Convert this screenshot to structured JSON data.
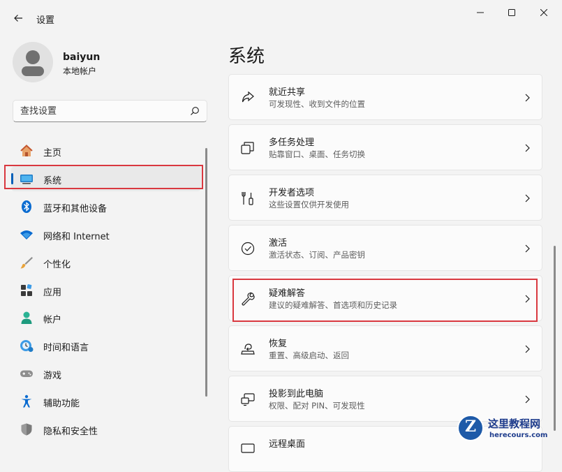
{
  "window": {
    "title": "设置",
    "controls": [
      "minimize",
      "maximize",
      "close"
    ]
  },
  "account": {
    "name": "baiyun",
    "type": "本地帐户"
  },
  "search": {
    "placeholder": "查找设置"
  },
  "nav": {
    "items": [
      {
        "label": "主页",
        "icon": "home-icon"
      },
      {
        "label": "系统",
        "icon": "monitor-icon",
        "selected": true
      },
      {
        "label": "蓝牙和其他设备",
        "icon": "bluetooth-icon"
      },
      {
        "label": "网络和 Internet",
        "icon": "wifi-icon"
      },
      {
        "label": "个性化",
        "icon": "brush-icon"
      },
      {
        "label": "应用",
        "icon": "apps-icon"
      },
      {
        "label": "帐户",
        "icon": "person-icon"
      },
      {
        "label": "时间和语言",
        "icon": "clock-globe-icon"
      },
      {
        "label": "游戏",
        "icon": "gamepad-icon"
      },
      {
        "label": "辅助功能",
        "icon": "accessibility-icon"
      },
      {
        "label": "隐私和安全性",
        "icon": "shield-icon"
      }
    ]
  },
  "main": {
    "title": "系统",
    "cards": [
      {
        "title": "就近共享",
        "subtitle": "可发现性、收到文件的位置",
        "icon": "share-icon"
      },
      {
        "title": "多任务处理",
        "subtitle": "贴靠窗口、桌面、任务切换",
        "icon": "multitask-icon"
      },
      {
        "title": "开发者选项",
        "subtitle": "这些设置仅供开发使用",
        "icon": "developer-tools-icon"
      },
      {
        "title": "激活",
        "subtitle": "激活状态、订阅、产品密钥",
        "icon": "check-circle-icon"
      },
      {
        "title": "疑难解答",
        "subtitle": "建议的疑难解答、首选项和历史记录",
        "icon": "wrench-icon",
        "highlighted": true
      },
      {
        "title": "恢复",
        "subtitle": "重置、高级启动、返回",
        "icon": "recovery-icon"
      },
      {
        "title": "投影到此电脑",
        "subtitle": "权限、配对 PIN、可发现性",
        "icon": "project-icon"
      },
      {
        "title": "远程桌面",
        "subtitle": "",
        "icon": "remote-desktop-icon"
      }
    ]
  },
  "watermark": {
    "badge": "Z",
    "text": "这里教程网",
    "url": "herecours.com"
  },
  "colors": {
    "accent": "#005fb8",
    "highlight_border": "#d9383f",
    "background": "#f3f3f3"
  }
}
